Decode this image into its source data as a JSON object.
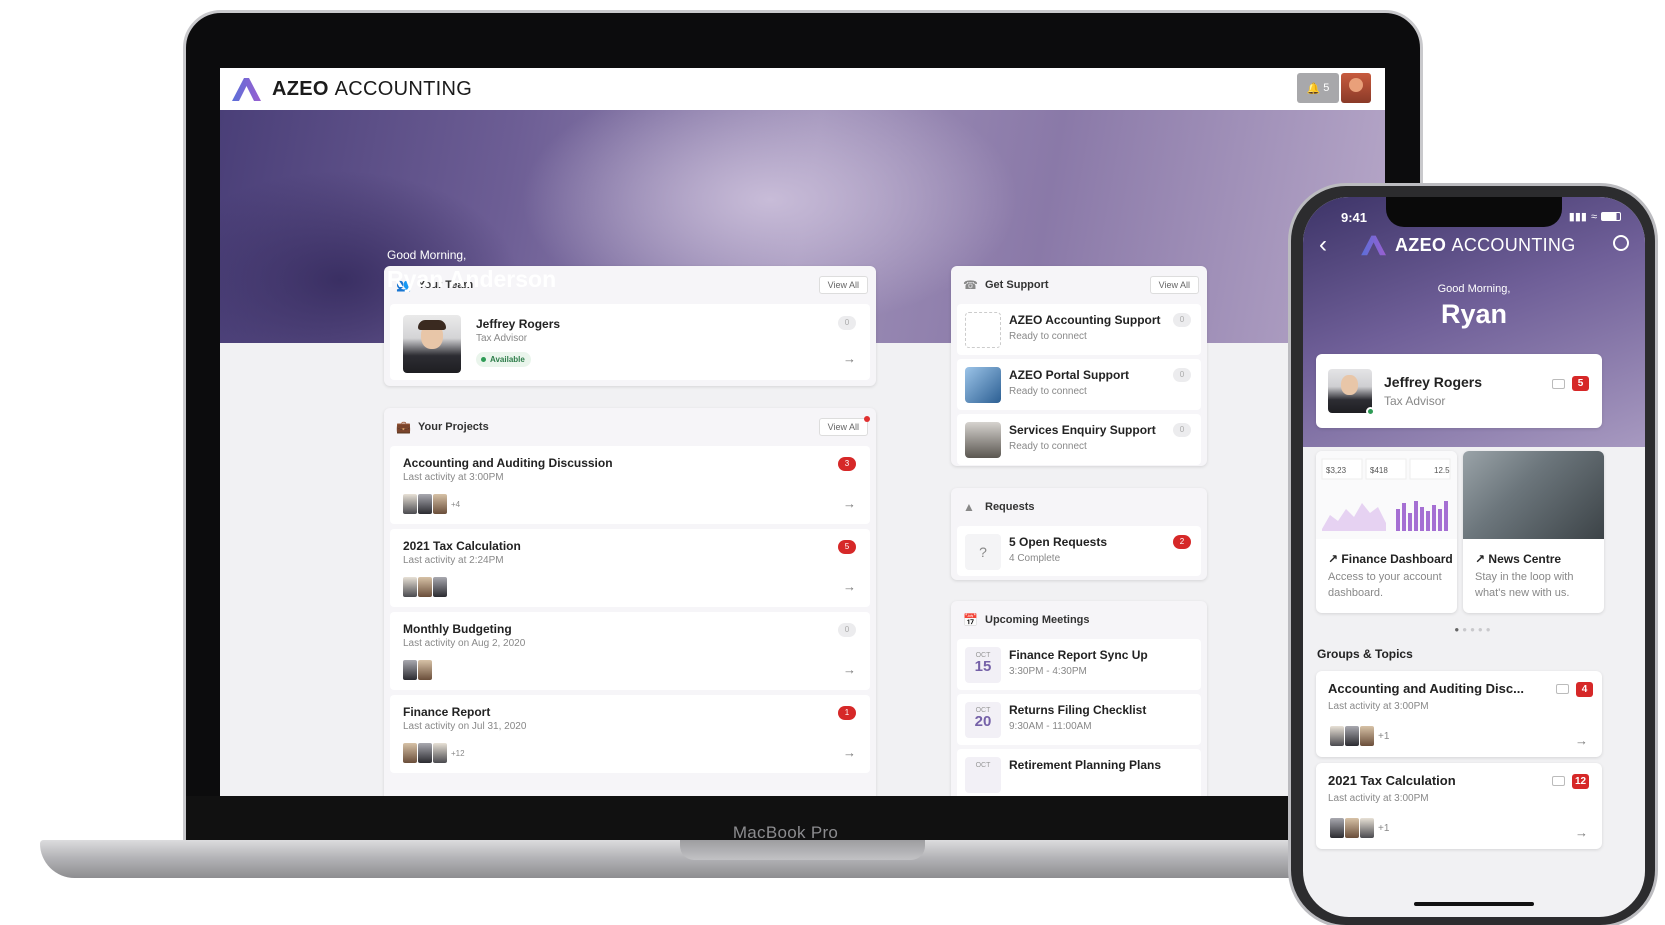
{
  "laptop": {
    "device_label": "MacBook Pro",
    "app": {
      "brand_bold": "AZEO",
      "brand_light": "ACCOUNTING",
      "notification_count": "5",
      "greeting": "Good Morning,",
      "user_name": "Ryan Anderson",
      "team": {
        "title": "Your Team",
        "view_all": "View All",
        "advisor_name": "Jeffrey Rogers",
        "advisor_role": "Tax Advisor",
        "status": "Available",
        "badge": "0"
      },
      "projects": {
        "title": "Your Projects",
        "view_all": "View All",
        "items": [
          {
            "title": "Accounting and Auditing Discussion",
            "sub": "Last activity at 3:00PM",
            "badge": "3",
            "more": "+4"
          },
          {
            "title": "2021 Tax Calculation",
            "sub": "Last activity at 2:24PM",
            "badge": "5",
            "more": ""
          },
          {
            "title": "Monthly Budgeting",
            "sub": "Last activity on Aug 2, 2020",
            "badge": "0",
            "more": ""
          },
          {
            "title": "Finance Report",
            "sub": "Last activity on Jul 31, 2020",
            "badge": "1",
            "more": "+12"
          }
        ]
      },
      "support": {
        "title": "Get Support",
        "view_all": "View All",
        "items": [
          {
            "title": "AZEO Accounting Support",
            "sub": "Ready to connect",
            "badge": "0"
          },
          {
            "title": "AZEO Portal Support",
            "sub": "Ready to connect",
            "badge": "0"
          },
          {
            "title": "Services Enquiry Support",
            "sub": "Ready to connect",
            "badge": "0"
          }
        ]
      },
      "requests": {
        "title": "Requests",
        "open": "5 Open Requests",
        "complete": "4 Complete",
        "badge": "2"
      },
      "meetings": {
        "title": "Upcoming Meetings",
        "items": [
          {
            "month": "OCT",
            "day": "15",
            "title": "Finance Report Sync Up",
            "time": "3:30PM - 4:30PM"
          },
          {
            "month": "OCT",
            "day": "20",
            "title": "Returns Filing Checklist",
            "time": "9:30AM - 11:00AM"
          },
          {
            "month": "OCT",
            "day": "",
            "title": "Retirement Planning Plans",
            "time": ""
          }
        ]
      }
    }
  },
  "phone": {
    "status_time": "9:41",
    "brand_bold": "AZEO",
    "brand_light": "ACCOUNTING",
    "greeting": "Good Morning,",
    "user_name": "Ryan",
    "advisor": {
      "name": "Jeffrey Rogers",
      "role": "Tax Advisor",
      "badge": "5"
    },
    "tiles": [
      {
        "title": "Finance Dashboard",
        "sub": "Access to your account dashboard.",
        "stats": [
          "$3,23",
          "$418",
          "12.5"
        ]
      },
      {
        "title": "News Centre",
        "sub": "Stay in the loop with what's new with us."
      }
    ],
    "section_title": "Groups & Topics",
    "groups": [
      {
        "title": "Accounting and Auditing Disc...",
        "sub": "Last activity at 3:00PM",
        "badge": "4",
        "more": "+1"
      },
      {
        "title": "2021 Tax Calculation",
        "sub": "Last activity at 3:00PM",
        "badge": "12",
        "more": "+1"
      }
    ]
  },
  "colors": {
    "accent_purple": "#7561a8",
    "badge_red": "#d62828",
    "available_green": "#2e9b55"
  }
}
